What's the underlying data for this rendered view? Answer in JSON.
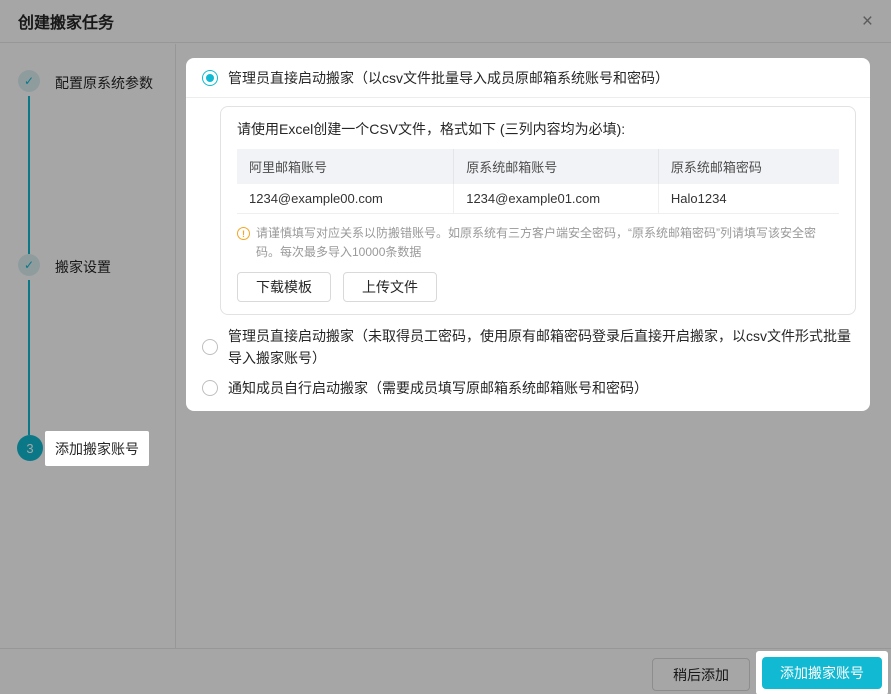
{
  "dialog": {
    "title": "创建搬家任务"
  },
  "icons": {
    "close": "×",
    "check": "✓",
    "warning": "!"
  },
  "steps": [
    {
      "label": "配置原系统参数",
      "state": "done"
    },
    {
      "label": "搬家设置",
      "state": "done"
    },
    {
      "label": "添加搬家账号",
      "state": "current",
      "number": "3"
    }
  ],
  "options": [
    {
      "label": "管理员直接启动搬家（以csv文件批量导入成员原邮箱系统账号和密码）",
      "selected": true
    },
    {
      "label": "管理员直接启动搬家（未取得员工密码，使用原有邮箱密码登录后直接开启搬家，以csv文件形式批量导入搬家账号）",
      "selected": false
    },
    {
      "label": "通知成员自行启动搬家（需要成员填写原邮箱系统邮箱账号和密码）",
      "selected": false
    }
  ],
  "csv_panel": {
    "instruction": "请使用Excel创建一个CSV文件，格式如下 (三列内容均为必填):",
    "table": {
      "headers": [
        "阿里邮箱账号",
        "原系统邮箱账号",
        "原系统邮箱密码"
      ],
      "rows": [
        [
          "1234@example00.com",
          "1234@example01.com",
          "Halo1234"
        ]
      ]
    },
    "note": "请谨慎填写对应关系以防搬错账号。如原系统有三方客户端安全密码，“原系统邮箱密码”列请填写该安全密码。每次最多导入10000条数据",
    "download_label": "下载模板",
    "upload_label": "上传文件"
  },
  "footer": {
    "later_label": "稍后添加",
    "primary_label": "添加搬家账号"
  },
  "colors": {
    "accent": "#12b9d2",
    "warning": "#f5a623",
    "overlay": "rgba(0,0,0,0.35)",
    "step_done_bg": "#dcf0f2"
  }
}
